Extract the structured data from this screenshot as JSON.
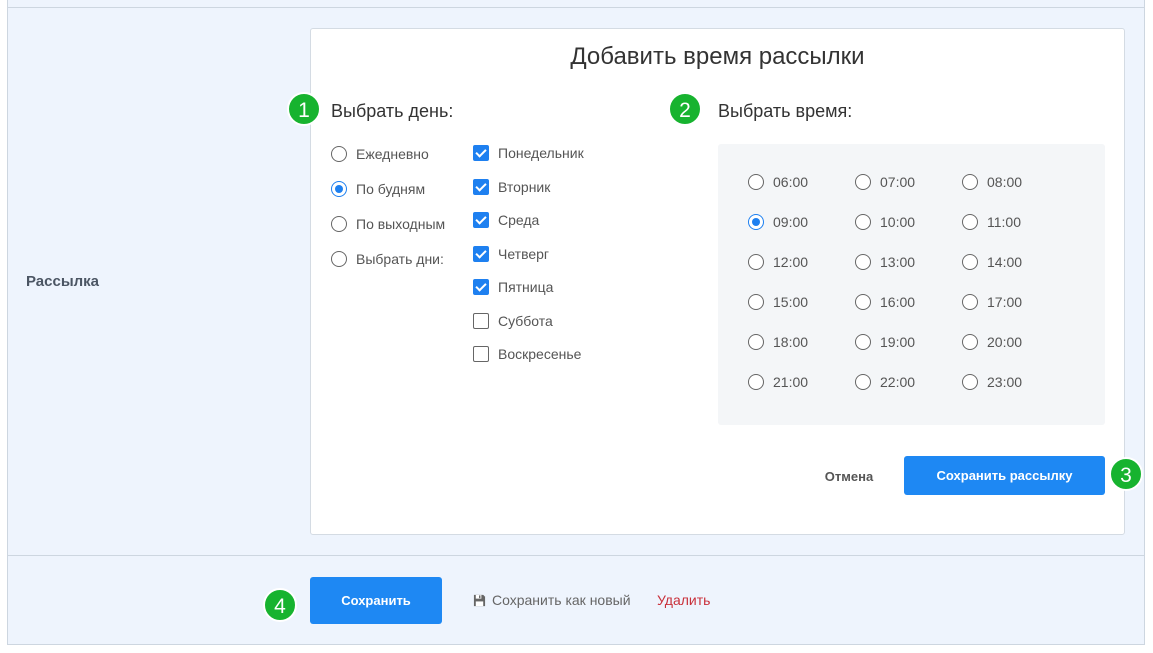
{
  "section_label": "Рассылка",
  "dialog": {
    "title": "Добавить время рассылки",
    "day_heading": "Выбрать день:",
    "time_heading": "Выбрать время:",
    "day_modes": [
      {
        "label": "Ежедневно",
        "selected": false
      },
      {
        "label": "По будням",
        "selected": true
      },
      {
        "label": "По выходным",
        "selected": false
      },
      {
        "label": "Выбрать дни:",
        "selected": false
      }
    ],
    "weekdays": [
      {
        "label": "Понедельник",
        "checked": true
      },
      {
        "label": "Вторник",
        "checked": true
      },
      {
        "label": "Среда",
        "checked": true
      },
      {
        "label": "Четверг",
        "checked": true
      },
      {
        "label": "Пятница",
        "checked": true
      },
      {
        "label": "Суббота",
        "checked": false
      },
      {
        "label": "Воскресенье",
        "checked": false
      }
    ],
    "times": [
      "06:00",
      "07:00",
      "08:00",
      "09:00",
      "10:00",
      "11:00",
      "12:00",
      "13:00",
      "14:00",
      "15:00",
      "16:00",
      "17:00",
      "18:00",
      "19:00",
      "20:00",
      "21:00",
      "22:00",
      "23:00"
    ],
    "selected_time": "09:00",
    "cancel_label": "Отмена",
    "save_mailing_label": "Сохранить рассылку"
  },
  "footer": {
    "save_label": "Сохранить",
    "save_new_label": "Сохранить как новый",
    "delete_label": "Удалить"
  },
  "badges": [
    "1",
    "2",
    "3",
    "4"
  ],
  "colors": {
    "accent": "#1e88f3",
    "badge": "#17b32f",
    "danger": "#c9303a"
  },
  "icons": {
    "save_new": "floppy-disk-icon"
  }
}
